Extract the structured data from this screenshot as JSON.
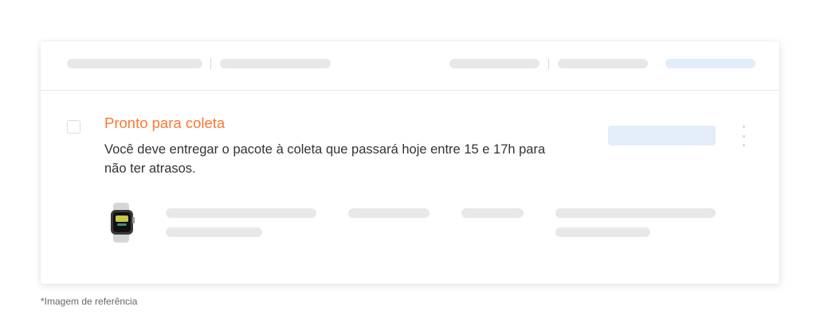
{
  "order_card": {
    "status_title": "Pronto para coleta",
    "status_description": "Você deve entregar o pacote à coleta que passará hoje entre 15 e 17h para não ter atrasos.",
    "product": {
      "icon": "smartwatch-icon"
    },
    "actions": {
      "more_icon": "kebab-menu-icon"
    }
  },
  "footnote": "*Imagem de referência",
  "colors": {
    "status_accent": "#ff7733",
    "placeholder_gray": "#e8e8e8",
    "placeholder_blue": "#e3edf8",
    "text_primary": "#333333"
  }
}
